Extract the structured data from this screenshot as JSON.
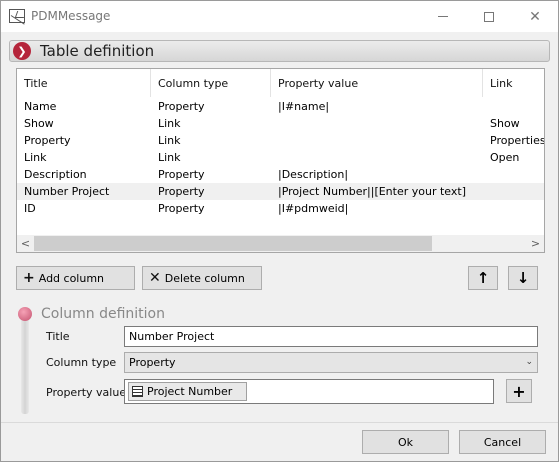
{
  "window": {
    "title": "PDMMessage",
    "close_glyph": "✕"
  },
  "section": {
    "title": "Table definition",
    "icon": "chevron-right-icon"
  },
  "table": {
    "columns": [
      "Title",
      "Column type",
      "Property value",
      "Link"
    ],
    "rows": [
      [
        "Name",
        "Property",
        "|I#name|",
        ""
      ],
      [
        "Show",
        "Link",
        "",
        "Show"
      ],
      [
        "Property",
        "Link",
        "",
        "Properties"
      ],
      [
        "Link",
        "Link",
        "",
        "Open"
      ],
      [
        "Description",
        "Property",
        "|Description|",
        ""
      ],
      [
        "Number Project",
        "Property",
        "|Project Number||[Enter your text]",
        ""
      ],
      [
        "ID",
        "Property",
        "|I#pdmweid|",
        ""
      ]
    ],
    "selected_row": 5,
    "scroll_left": "<",
    "scroll_right": ">"
  },
  "buttons": {
    "add_column": "Add column",
    "delete_column": "Delete column",
    "add_glyph": "+",
    "delete_glyph": "✕",
    "up_glyph": "↑",
    "down_glyph": "↓"
  },
  "column_definition": {
    "title": "Column definition",
    "title_label": "Title",
    "title_value": "Number Project",
    "type_label": "Column type",
    "type_value": "Property",
    "type_arrow": "⌄",
    "prop_label": "Property value",
    "prop_token": "Project Number",
    "add_prop_glyph": "+"
  },
  "footer": {
    "ok": "Ok",
    "cancel": "Cancel"
  },
  "colors": {
    "accent": "#b5253b",
    "selected_row": "#f0f0f0"
  }
}
